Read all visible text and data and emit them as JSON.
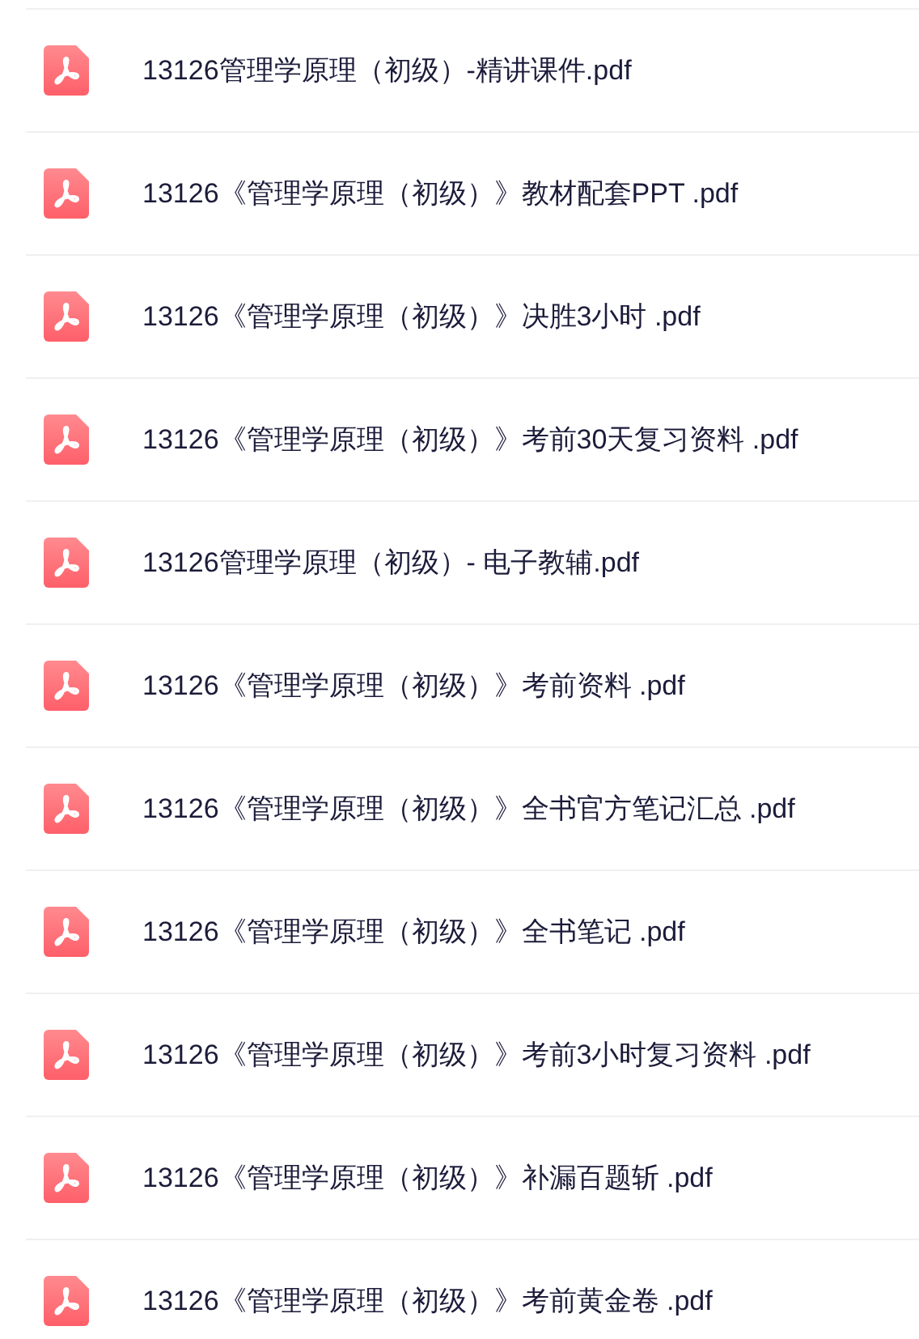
{
  "files": [
    {
      "name": "13126管理学原理（初级）-精讲课件.pdf"
    },
    {
      "name": "13126《管理学原理（初级）》教材配套PPT .pdf"
    },
    {
      "name": "13126《管理学原理（初级）》决胜3小时 .pdf"
    },
    {
      "name": "13126《管理学原理（初级）》考前30天复习资料 .pdf"
    },
    {
      "name": "13126管理学原理（初级）- 电子教辅.pdf"
    },
    {
      "name": "13126《管理学原理（初级）》考前资料 .pdf"
    },
    {
      "name": "13126《管理学原理（初级）》全书官方笔记汇总 .pdf"
    },
    {
      "name": "13126《管理学原理（初级）》全书笔记 .pdf"
    },
    {
      "name": "13126《管理学原理（初级）》考前3小时复习资料 .pdf"
    },
    {
      "name": "13126《管理学原理（初级）》补漏百题斩 .pdf"
    },
    {
      "name": "13126《管理学原理（初级）》考前黄金卷 .pdf"
    }
  ]
}
